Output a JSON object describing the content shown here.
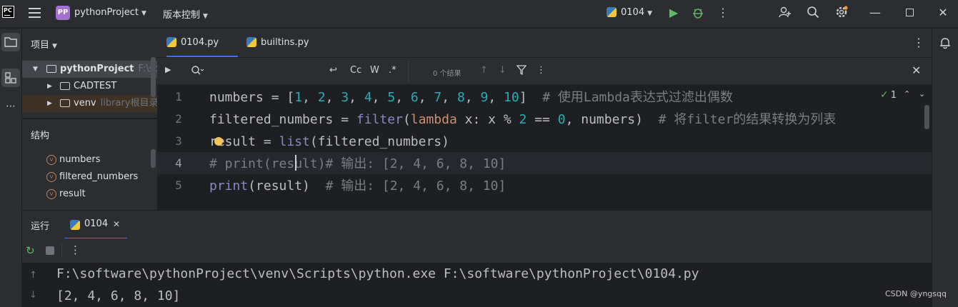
{
  "titlebar": {
    "logo": "PC",
    "project_badge": "PP",
    "project_name": "pythonProject",
    "vcs_label": "版本控制",
    "run_config": "0104"
  },
  "project_panel": {
    "title": "项目",
    "root_name": "pythonProject",
    "root_path": "F:\\soft",
    "items": [
      {
        "label": "CADTEST",
        "hint": ""
      },
      {
        "label": "venv",
        "hint": "library根目录"
      }
    ]
  },
  "structure_panel": {
    "title": "结构",
    "items": [
      "numbers",
      "filtered_numbers",
      "result"
    ],
    "badge": "v"
  },
  "tabs": [
    {
      "label": "0104.py"
    },
    {
      "label": "builtins.py"
    }
  ],
  "findbar": {
    "match_case": "Cc",
    "words": "W",
    "regex": ".*",
    "results": "0 个结果"
  },
  "editor": {
    "line_numbers": [
      "1",
      "2",
      "3",
      "4",
      "5"
    ],
    "current_line": 4,
    "inspection_count": "1",
    "lines": [
      [
        {
          "t": "numbers = [",
          "c": ""
        },
        {
          "t": "1",
          "c": "num"
        },
        {
          "t": ", ",
          "c": ""
        },
        {
          "t": "2",
          "c": "num"
        },
        {
          "t": ", ",
          "c": ""
        },
        {
          "t": "3",
          "c": "num"
        },
        {
          "t": ", ",
          "c": ""
        },
        {
          "t": "4",
          "c": "num"
        },
        {
          "t": ", ",
          "c": ""
        },
        {
          "t": "5",
          "c": "num"
        },
        {
          "t": ", ",
          "c": ""
        },
        {
          "t": "6",
          "c": "num"
        },
        {
          "t": ", ",
          "c": ""
        },
        {
          "t": "7",
          "c": "num"
        },
        {
          "t": ", ",
          "c": ""
        },
        {
          "t": "8",
          "c": "num"
        },
        {
          "t": ", ",
          "c": ""
        },
        {
          "t": "9",
          "c": "num"
        },
        {
          "t": ", ",
          "c": ""
        },
        {
          "t": "10",
          "c": "num"
        },
        {
          "t": "]  ",
          "c": ""
        },
        {
          "t": "# 使用Lambda表达式过滤出偶数",
          "c": "cm"
        }
      ],
      [
        {
          "t": "filtered_numbers = ",
          "c": ""
        },
        {
          "t": "filter",
          "c": "builtin"
        },
        {
          "t": "(",
          "c": ""
        },
        {
          "t": "lambda",
          "c": "kw"
        },
        {
          "t": " x: x % ",
          "c": ""
        },
        {
          "t": "2",
          "c": "num"
        },
        {
          "t": " == ",
          "c": ""
        },
        {
          "t": "0",
          "c": "num"
        },
        {
          "t": ", numbers)  ",
          "c": ""
        },
        {
          "t": "# 将filter的结果转换为列表",
          "c": "cm"
        }
      ],
      [
        {
          "t": "result = ",
          "c": ""
        },
        {
          "t": "list",
          "c": "builtin"
        },
        {
          "t": "(filtered_numbers)",
          "c": ""
        }
      ],
      [
        {
          "t": "# print(result)# 输出: [2, 4, 6, 8, 10]",
          "c": "cm"
        }
      ],
      [
        {
          "t": "print",
          "c": "builtin"
        },
        {
          "t": "(result)  ",
          "c": ""
        },
        {
          "t": "# 输出: [2, 4, 6, 8, 10]",
          "c": "cm"
        }
      ]
    ]
  },
  "run_panel": {
    "title": "运行",
    "tab_label": "0104"
  },
  "console": {
    "lines": [
      "F:\\software\\pythonProject\\venv\\Scripts\\python.exe F:\\software\\pythonProject\\0104.py",
      "[2, 4, 6, 8, 10]"
    ]
  },
  "watermark": "CSDN @yngsqq"
}
